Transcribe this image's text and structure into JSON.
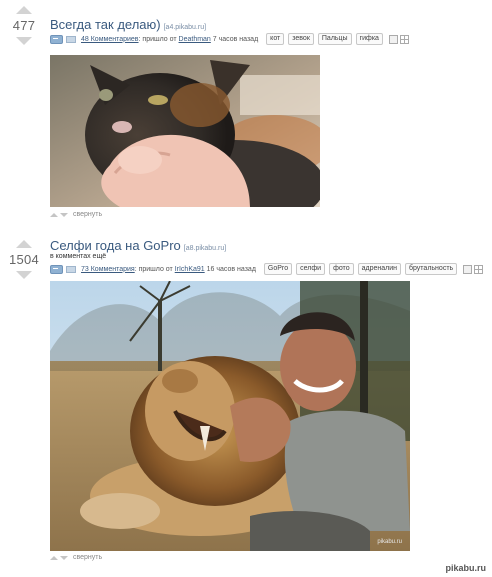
{
  "posts": [
    {
      "rating": "477",
      "title": "Всегда так делаю)",
      "domain": "[a4.pikabu.ru]",
      "comments": "48 Комментариев",
      "posted_text": ": пришло от",
      "author": "Deathman",
      "time": "7 часов назад",
      "tags": [
        "кот",
        "зевок",
        "Пальцы",
        "гифка"
      ],
      "collapse": "свернуть"
    },
    {
      "rating": "1504",
      "title": "Селфи года на GoPro",
      "domain": "[a8.pikabu.ru]",
      "subtitle": "в комментах ещё",
      "comments": "73 Комментария",
      "posted_text": ": пришло от",
      "author": "IrIchKa91",
      "time": "16 часов назад",
      "tags": [
        "GoPro",
        "селфи",
        "фото",
        "адреналин",
        "брутальность"
      ],
      "collapse": "свернуть",
      "image_watermark": "pikabu.ru"
    }
  ],
  "site_watermark": "pikabu.ru"
}
